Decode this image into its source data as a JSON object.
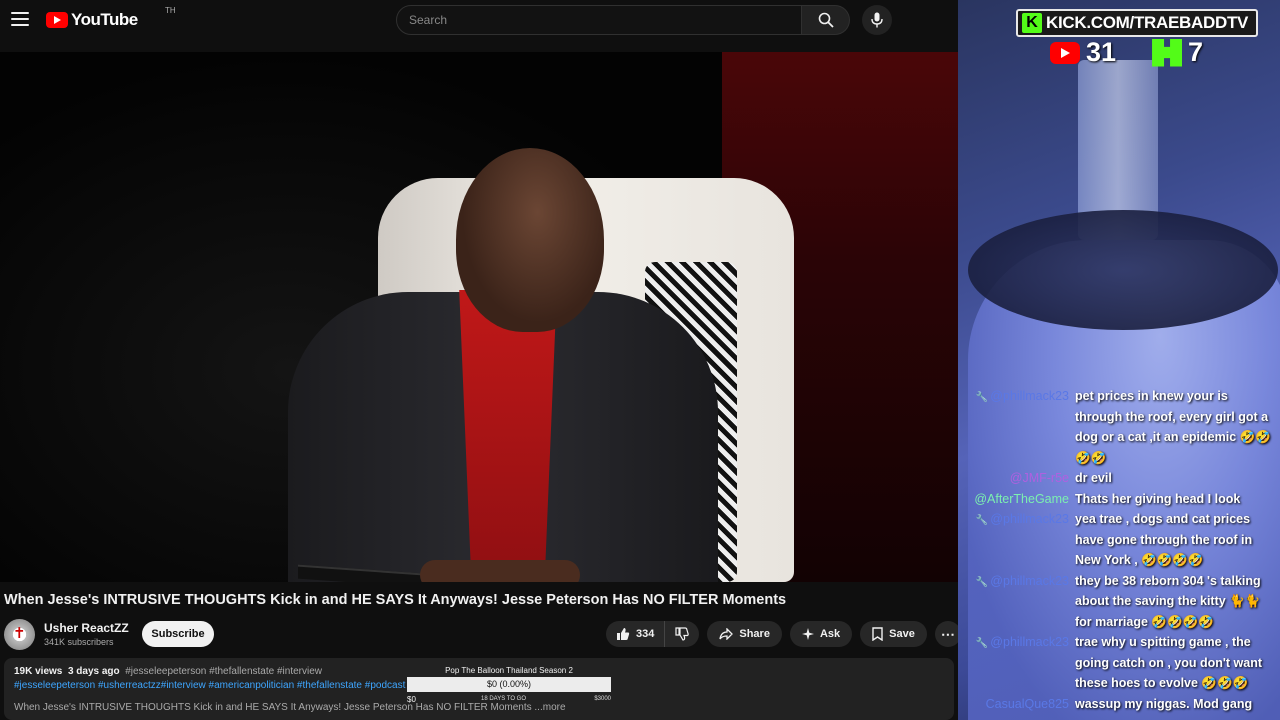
{
  "youtube": {
    "logo_text": "YouTube",
    "logo_region": "TH",
    "search_placeholder": "Search",
    "video_title": "When Jesse's INTRUSIVE THOUGHTS Kick in and HE SAYS It Anyways! Jesse Peterson Has NO FILTER Moments",
    "channel_name": "Usher ReactZZ",
    "subscribers": "341K subscribers",
    "subscribe_label": "Subscribe",
    "like_count": "334",
    "share_label": "Share",
    "ask_label": "Ask",
    "save_label": "Save",
    "views": "19K views",
    "age": "3 days ago",
    "hashtags_line1": "#jesseleepeterson #thefallenstate #interview",
    "hashtags_line2": "#jesseleepeterson #usherreactzz#interview  #americanpolitician #thefallenstate #podcast",
    "desc_preview": "When Jesse's INTRUSIVE THOUGHTS Kick in and HE SAYS It Anyways! Jesse Peterson Has NO FILTER Moments    ...more"
  },
  "fundraiser": {
    "title": "Pop The Balloon Thailand Season 2",
    "amount": "$0 (0.00%)",
    "min": "$0",
    "days_left": "18 DAYS TO GO",
    "goal": "$3000"
  },
  "stream_overlay": {
    "kick_url": "KICK.COM/TRAEBADDTV",
    "youtube_viewers": "31",
    "kick_viewers": "7"
  },
  "chat": [
    {
      "user": "@phillmack23",
      "text": "pet prices in knew your is through the roof, every girl got a dog or a cat ,it an epidemic 🤣🤣🤣🤣",
      "color": "#5a78e6",
      "mod": true
    },
    {
      "user": "@JMF-r5e",
      "text": "dr evil",
      "color": "#b060e0",
      "mod": false
    },
    {
      "user": "@AfterTheGame",
      "text": "Thats her giving head I look",
      "color": "#7cf0b0",
      "mod": false
    },
    {
      "user": "@phillmack23",
      "text": "yea trae , dogs and cat prices have gone through the roof in New York , 🤣🤣🤣🤣",
      "color": "#5a78e6",
      "mod": true
    },
    {
      "user": "@phillmack23",
      "text": "they be 38 reborn 304 's talking about the saving the kitty 🐈🐈 for marriage 🤣🤣🤣🤣",
      "color": "#5a78e6",
      "mod": true
    },
    {
      "user": "@phillmack23",
      "text": "trae why u spitting game , the going catch on , you don't want these hoes to evolve 🤣🤣🤣",
      "color": "#5a78e6",
      "mod": true
    },
    {
      "user": "CasualQue825",
      "text": "wassup my niggas. Mod gang",
      "color": "#5a78e6",
      "mod": false
    }
  ]
}
